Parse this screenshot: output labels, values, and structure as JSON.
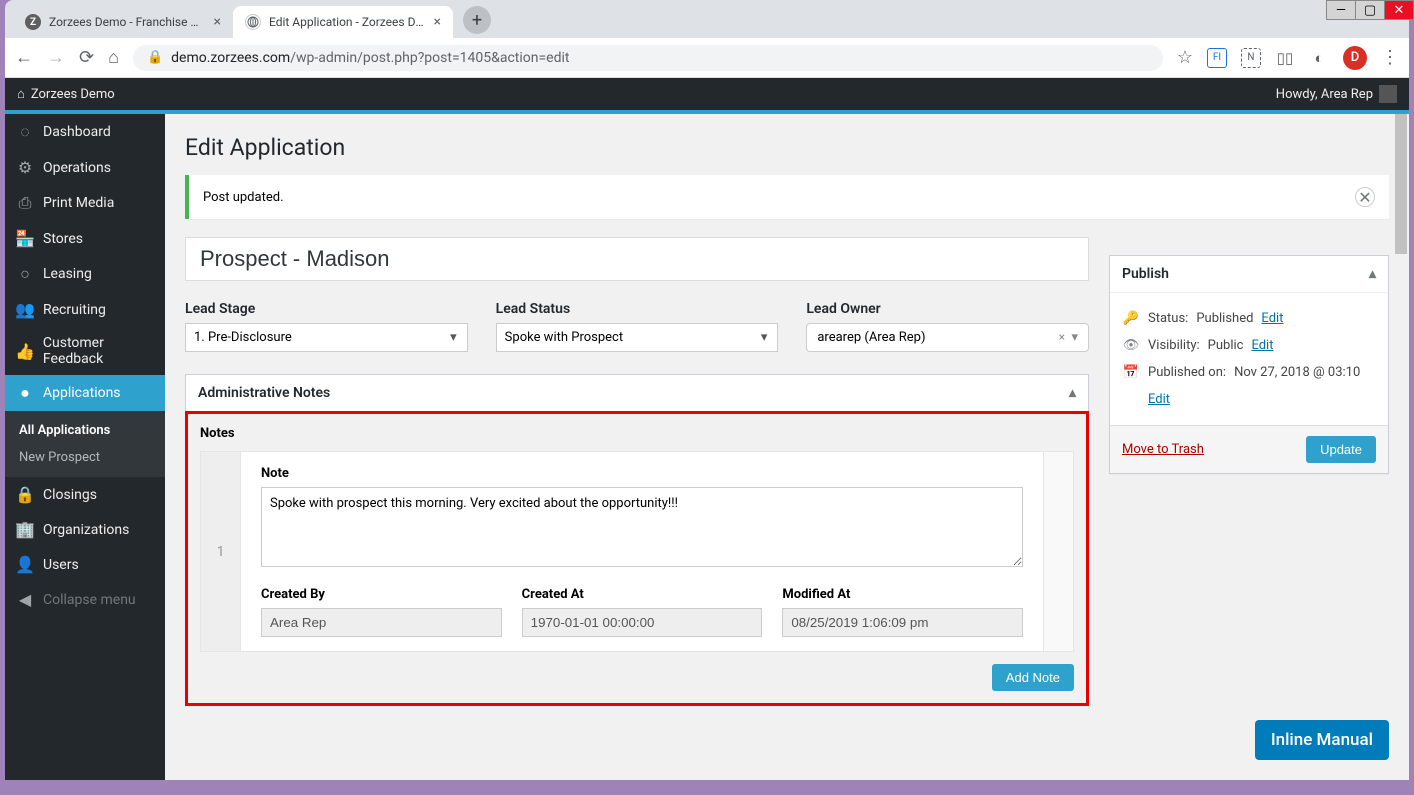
{
  "browser": {
    "tabs": [
      {
        "favicon_letter": "Z",
        "title": "Zorzees Demo - Franchise Manag"
      },
      {
        "favicon_letter": "",
        "title": "Edit Application - Zorzees Demo"
      }
    ],
    "url_domain": "demo.zorzees.com",
    "url_path": "/wp-admin/post.php?post=1405&action=edit",
    "avatar_letter": "D"
  },
  "adminbar": {
    "site_name": "Zorzees Demo",
    "howdy": "Howdy, Area Rep"
  },
  "sidebar": {
    "items": [
      {
        "label": "Dashboard",
        "icon": "dashboard"
      },
      {
        "label": "Operations",
        "icon": "gear"
      },
      {
        "label": "Print Media",
        "icon": "print"
      },
      {
        "label": "Stores",
        "icon": "store"
      },
      {
        "label": "Leasing",
        "icon": "pin"
      },
      {
        "label": "Recruiting",
        "icon": "group"
      },
      {
        "label": "Customer Feedback",
        "icon": "thumb"
      },
      {
        "label": "Applications",
        "icon": "app",
        "current": true
      },
      {
        "label": "Closings",
        "icon": "lock"
      },
      {
        "label": "Organizations",
        "icon": "building"
      },
      {
        "label": "Users",
        "icon": "user"
      },
      {
        "label": "Collapse menu",
        "icon": "collapse",
        "dim": true
      }
    ],
    "submenu": [
      {
        "label": "All Applications",
        "cur": true
      },
      {
        "label": "New Prospect"
      }
    ]
  },
  "page": {
    "title": "Edit Application",
    "notice": "Post updated.",
    "post_title": "Prospect - Madison",
    "lead_stage_label": "Lead Stage",
    "lead_stage_value": "1. Pre-Disclosure",
    "lead_status_label": "Lead Status",
    "lead_status_value": "Spoke with Prospect",
    "lead_owner_label": "Lead Owner",
    "lead_owner_value": "arearep (Area Rep)",
    "admin_notes_heading": "Administrative Notes",
    "notes_label": "Notes",
    "note_field_label": "Note",
    "note_number": "1",
    "note_text": "Spoke with prospect this morning. Very excited about the opportunity!!!",
    "created_by_label": "Created By",
    "created_by_value": "Area Rep",
    "created_at_label": "Created At",
    "created_at_value": "1970-01-01 00:00:00",
    "modified_at_label": "Modified At",
    "modified_at_value": "08/25/2019 1:06:09 pm",
    "add_note_label": "Add Note"
  },
  "publish": {
    "heading": "Publish",
    "status_label": "Status:",
    "status_value": "Published",
    "visibility_label": "Visibility:",
    "visibility_value": "Public",
    "published_on_label": "Published on:",
    "published_on_value": "Nov 27, 2018 @ 03:10",
    "edit_label": "Edit",
    "trash_label": "Move to Trash",
    "update_label": "Update"
  },
  "inline_manual": "Inline Manual"
}
